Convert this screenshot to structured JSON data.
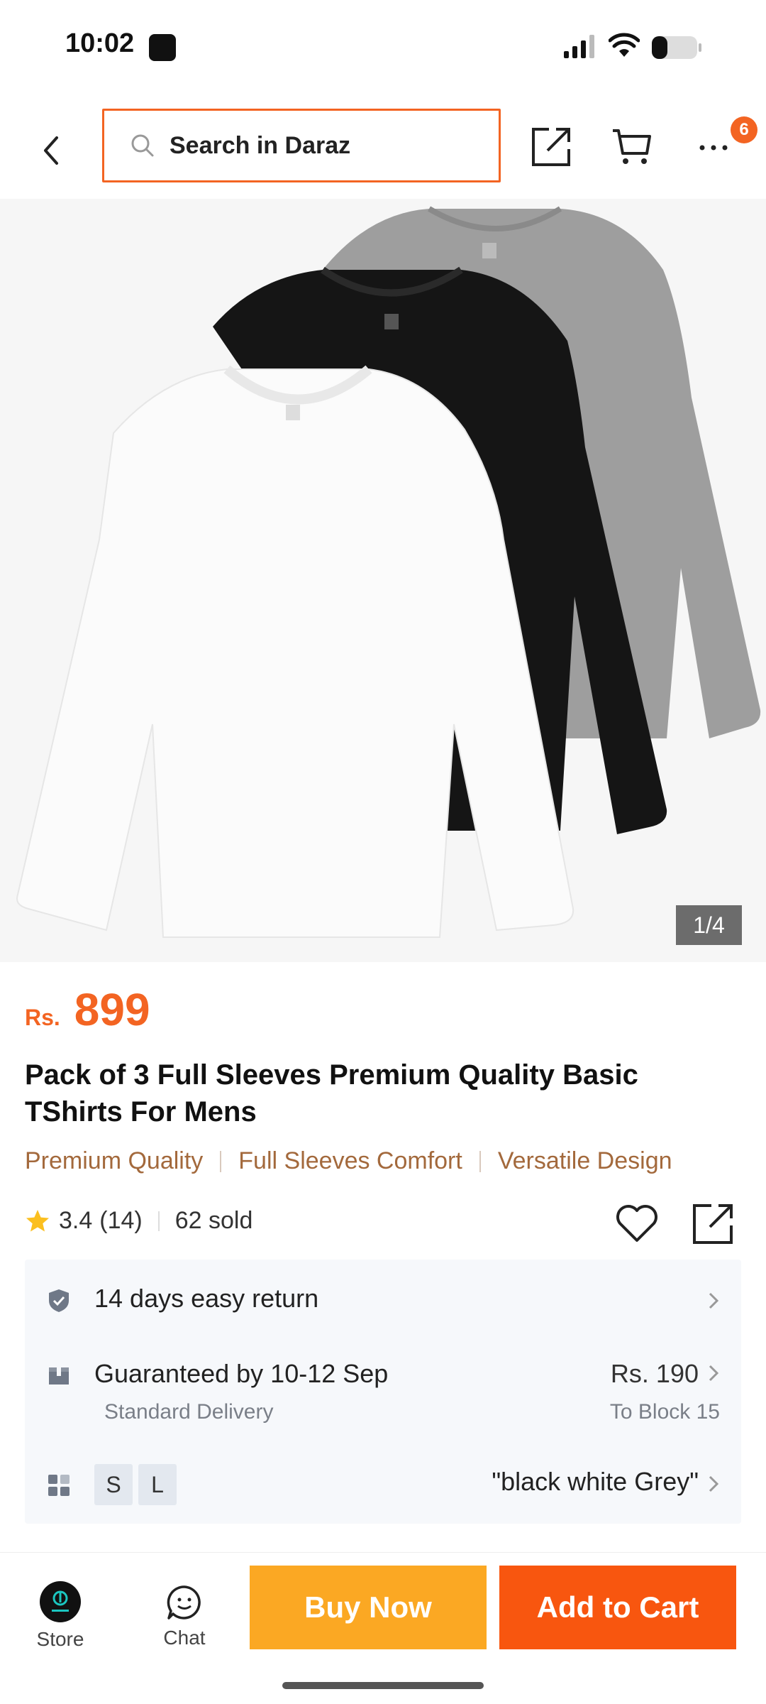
{
  "status_bar": {
    "time": "10:02"
  },
  "header": {
    "search_placeholder": "Search in Daraz",
    "more_badge": "6"
  },
  "gallery": {
    "counter": "1/4"
  },
  "product": {
    "currency": "Rs.",
    "price": "899",
    "title": "Pack of 3 Full Sleeves Premium Quality Basic TShirts For Mens",
    "tags": [
      "Premium Quality",
      "Full Sleeves Comfort",
      "Versatile Design"
    ],
    "rating": "3.4",
    "reviews": "(14)",
    "sold": "62 sold"
  },
  "info": {
    "return_text": "14 days easy return",
    "delivery_text": "Guaranteed by 10-12 Sep",
    "delivery_type": "Standard Delivery",
    "delivery_price": "Rs. 190",
    "delivery_to": "To Block 15",
    "sizes": [
      "S",
      "L"
    ],
    "variant": "\"black white Grey\""
  },
  "bottom_bar": {
    "store_label": "Store",
    "chat_label": "Chat",
    "buy_now": "Buy Now",
    "add_to_cart": "Add to Cart"
  },
  "colors": {
    "accent": "#f36422",
    "buy_now": "#fba823",
    "add_to_cart": "#f8560f",
    "tag_text": "#a3693c"
  }
}
